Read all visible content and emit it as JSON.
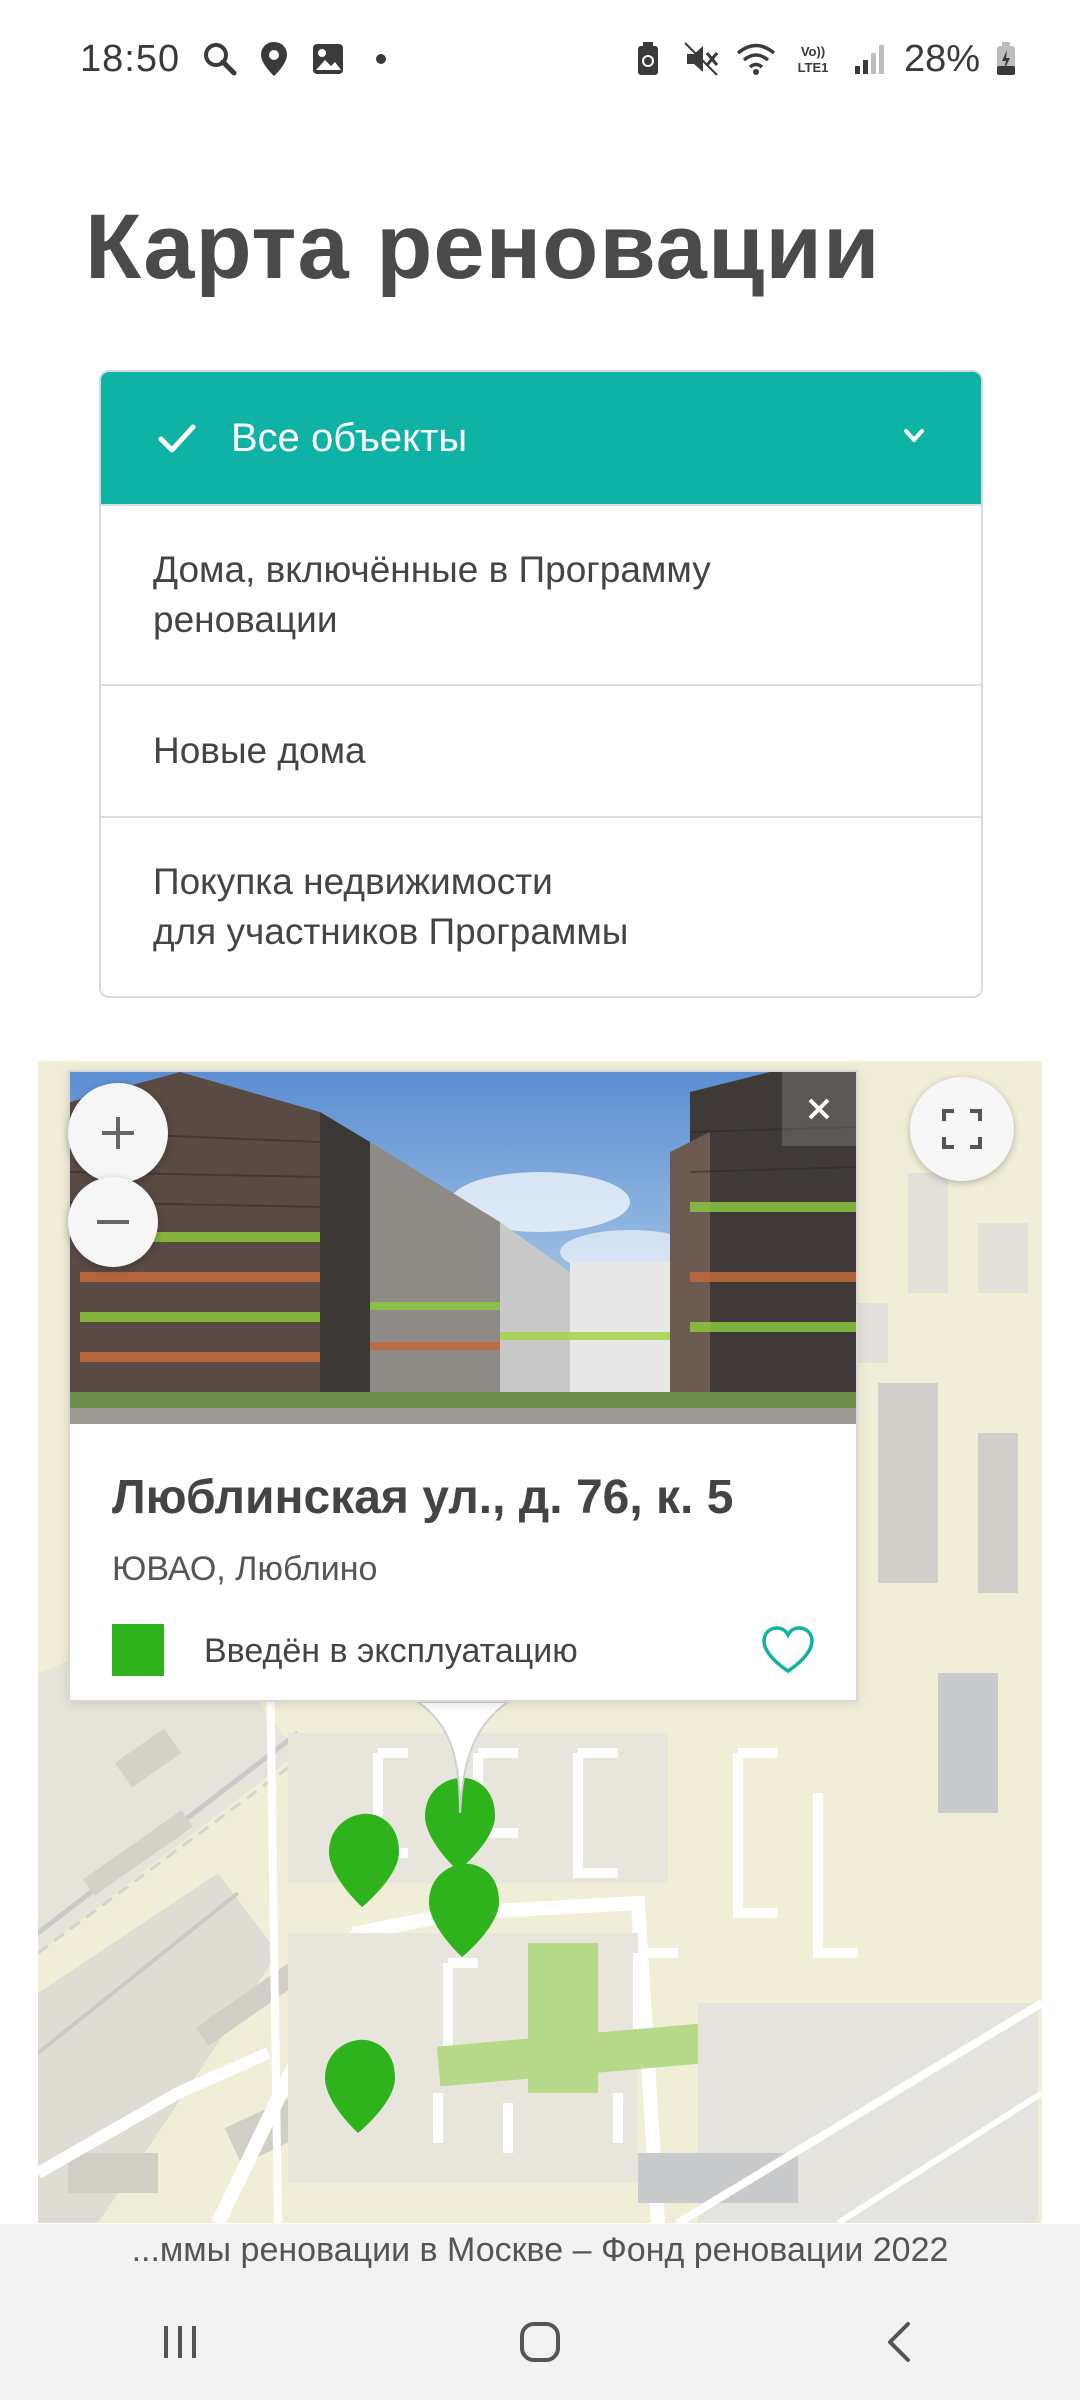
{
  "status_bar": {
    "time": "18:50",
    "battery": "28%",
    "network": "VoLTE1"
  },
  "page": {
    "title": "Карта реновации"
  },
  "filter": {
    "selected_label": "Все объекты",
    "options": [
      {
        "line1": "Дома, включённые в Программу",
        "line2": "реновации"
      },
      {
        "line1": "Новые дома",
        "line2": ""
      },
      {
        "line1": "Покупка недвижимости",
        "line2": "для участников Программы"
      }
    ]
  },
  "map": {
    "popup": {
      "address": "Люблинская ул., д. 76, к. 5",
      "district": "ЮВАО, Люблино",
      "status": "Введён в эксплуатацию",
      "status_color": "#2eb31c"
    },
    "marker_color": "#2eb31c"
  },
  "browser": {
    "page_title": "...ммы реновации в Москве – Фонд реновации 2022"
  },
  "colors": {
    "accent": "#0fb3a5",
    "title": "#4a4a4a"
  },
  "icons": {
    "check": "check-icon",
    "chevron": "chevron-down-icon",
    "zoom_in": "plus-icon",
    "zoom_out": "minus-icon",
    "fullscreen": "fullscreen-icon",
    "close": "close-icon",
    "favorite": "heart-icon"
  }
}
